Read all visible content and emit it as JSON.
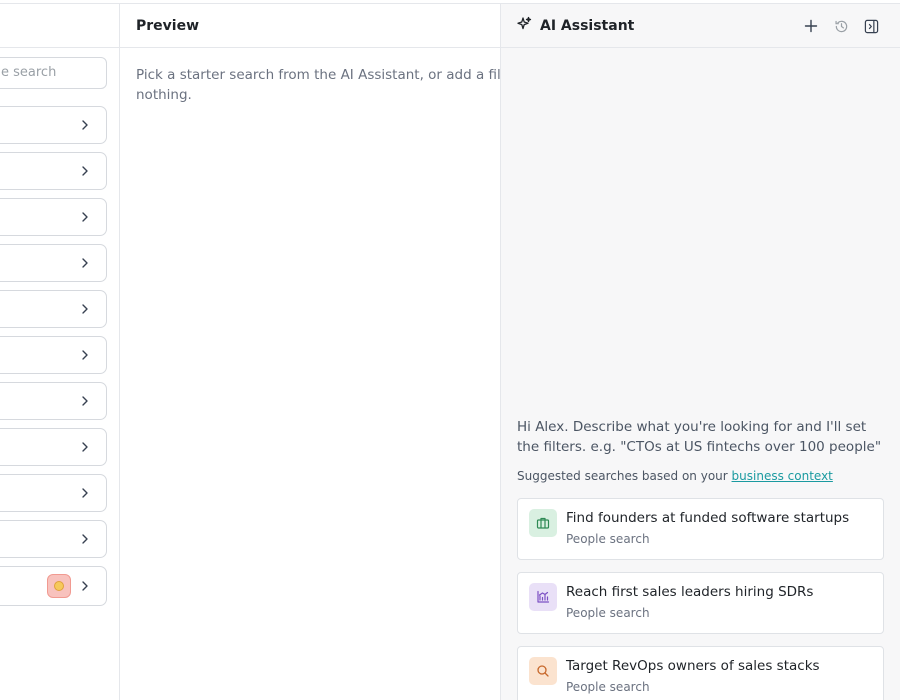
{
  "filters": {
    "search_placeholder": "e search",
    "row_count": 11
  },
  "preview": {
    "title": "Preview",
    "empty_message": "Pick a starter search from the AI Assistant, or add a filter. Previewing costs nothing."
  },
  "assistant": {
    "title": "AI Assistant",
    "greeting": "Hi Alex. Describe what you're looking for and I'll set the filters. e.g. \"CTOs at US fintechs over 100 people\"",
    "suggest_prefix": "Suggested searches based on your ",
    "suggest_link": "business context",
    "suggestions": [
      {
        "title": "Find founders at funded software startups",
        "subtitle": "People search",
        "icon": "briefcase-icon",
        "icon_bg": "#d9f0e1",
        "icon_color": "#2f8a55"
      },
      {
        "title": "Reach first sales leaders hiring SDRs",
        "subtitle": "People search",
        "icon": "chart-icon",
        "icon_bg": "#e9e0f7",
        "icon_color": "#7c4fc4"
      },
      {
        "title": "Target RevOps owners of sales stacks",
        "subtitle": "People search",
        "icon": "search-icon",
        "icon_bg": "#fbe3cf",
        "icon_color": "#c7672a"
      }
    ]
  },
  "colors": {
    "accent_link": "#1a9aa0",
    "border": "#e5e7eb",
    "panel_bg": "#f7f7f8"
  }
}
